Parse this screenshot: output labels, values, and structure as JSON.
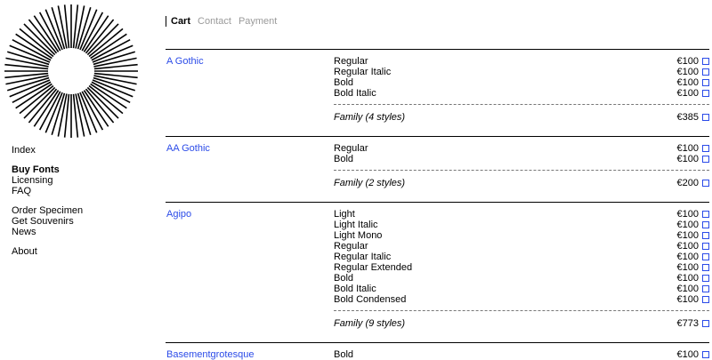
{
  "nav": {
    "groups": [
      [
        "Index"
      ],
      [
        "Buy Fonts",
        "Licensing",
        "FAQ"
      ],
      [
        "Order Specimen",
        "Get Souvenirs",
        "News"
      ],
      [
        "About"
      ]
    ],
    "active": "Buy Fonts"
  },
  "tabs": [
    {
      "label": "Cart",
      "active": true
    },
    {
      "label": "Contact",
      "active": false
    },
    {
      "label": "Payment",
      "active": false
    }
  ],
  "fonts": [
    {
      "name": "A Gothic",
      "styles": [
        {
          "name": "Regular",
          "price": "€100"
        },
        {
          "name": "Regular Italic",
          "price": "€100"
        },
        {
          "name": "Bold",
          "price": "€100"
        },
        {
          "name": "Bold Italic",
          "price": "€100"
        }
      ],
      "family_label": "Family (4 styles)",
      "family_price": "€385"
    },
    {
      "name": "AA Gothic",
      "styles": [
        {
          "name": "Regular",
          "price": "€100"
        },
        {
          "name": "Bold",
          "price": "€100"
        }
      ],
      "family_label": "Family (2 styles)",
      "family_price": "€200"
    },
    {
      "name": "Agipo",
      "styles": [
        {
          "name": "Light",
          "price": "€100"
        },
        {
          "name": "Light Italic",
          "price": "€100"
        },
        {
          "name": "Light Mono",
          "price": "€100"
        },
        {
          "name": "Regular",
          "price": "€100"
        },
        {
          "name": "Regular Italic",
          "price": "€100"
        },
        {
          "name": "Regular Extended",
          "price": "€100"
        },
        {
          "name": "Bold",
          "price": "€100"
        },
        {
          "name": "Bold Italic",
          "price": "€100"
        },
        {
          "name": "Bold Condensed",
          "price": "€100"
        }
      ],
      "family_label": "Family (9 styles)",
      "family_price": "€773"
    },
    {
      "name": "Basementgrotesque",
      "styles": [
        {
          "name": "Bold",
          "price": "€100"
        }
      ],
      "family_label": "",
      "family_price": ""
    }
  ],
  "colors": {
    "link": "#2b4be8",
    "muted": "#9a9a9a"
  },
  "icons": {
    "logo": "sunburst-logo-icon",
    "checkbox": "checkbox-icon"
  }
}
